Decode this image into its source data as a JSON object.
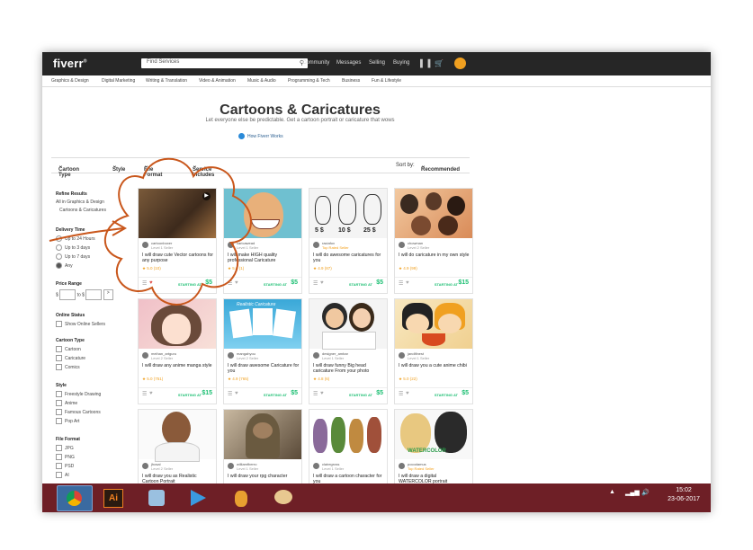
{
  "header": {
    "logo": "fiverr",
    "logo_mark": "®",
    "search_placeholder": "Find Services",
    "nav": [
      "Community",
      "Messages",
      "Selling",
      "Buying"
    ]
  },
  "categories": [
    "Graphics & Design",
    "Digital Marketing",
    "Writing & Translation",
    "Video & Animation",
    "Music & Audio",
    "Programming & Tech",
    "Business",
    "Fun & Lifestyle"
  ],
  "page": {
    "title": "Cartoons & Caricatures",
    "subtitle": "Let everyone else be predictable. Get a cartoon portrait or caricature that wows",
    "how_link": "How Fiverr Works"
  },
  "filters": {
    "cartoon_type": "Cartoon Type",
    "style": "Style",
    "file_format": "File Format",
    "service_includes": "Service Includes",
    "sort_label": "Sort by:",
    "sort_value": "Recommended"
  },
  "sidebar": {
    "refine": "Refine Results",
    "all_in": "All in Graphics & Design",
    "current": "Cartoons & Caricatures",
    "delivery_title": "Delivery Time",
    "delivery": [
      "Up to 24 Hours",
      "Up to 3 days",
      "Up to 7 days",
      "Any"
    ],
    "price_title": "Price Range",
    "price_from": "$",
    "price_to": "to $",
    "online_title": "Online Status",
    "online_opt": "Show Online Sellers",
    "type_title": "Cartoon Type",
    "type_opts": [
      "Cartoon",
      "Caricature",
      "Comics"
    ],
    "style_title": "Style",
    "style_opts": [
      "Freestyle Drawing",
      "Anime",
      "Famous Cartoons",
      "Pop Art"
    ],
    "format_title": "File Format",
    "format_opts": [
      "JPG",
      "PNG",
      "PSD",
      "AI"
    ]
  },
  "gigs": [
    {
      "seller": "cartoonboxer",
      "level": "Level 1 Seller",
      "desc": "I will draw cute Vector cartoons for any purpose",
      "rating": "5.0 (10)",
      "starting": "STARTING AT",
      "price": "$5"
    },
    {
      "seller": "caricawead",
      "level": "Level 1 Seller",
      "desc": "I will make HIGH quality professional Caricature",
      "rating": "5.0 (1)",
      "starting": "STARTING AT",
      "price": "$5"
    },
    {
      "seller": "raciafox",
      "level": "Top Rated Seller",
      "desc": "I will do awesome caricatures for you",
      "rating": "4.9 (87)",
      "starting": "STARTING AT",
      "price": "$5"
    },
    {
      "seller": "chowman",
      "level": "Level 2 Seller",
      "desc": "I will do caricature in my own style",
      "rating": "4.9 (99)",
      "starting": "STARTING AT",
      "price": "$15"
    },
    {
      "seller": "meihan_artguru",
      "level": "Level 2 Seller",
      "desc": "I will draw any anime manga style",
      "rating": "5.0 (751)",
      "starting": "STARTING AT",
      "price": "$15"
    },
    {
      "seller": "mangahyou",
      "level": "Level 2 Seller",
      "desc": "I will draw awesome Caricature for you",
      "rating": "4.9 (765)",
      "starting": "STARTING AT",
      "price": "$5"
    },
    {
      "seller": "designer_ambar",
      "level": "Level 1 Seller",
      "desc": "I will draw funny Big head caricature From your photo",
      "rating": "4.8 (6)",
      "starting": "STARTING AT",
      "price": "$5"
    },
    {
      "seller": "jandifinest",
      "level": "Level 1 Seller",
      "desc": "I will draw you a cute anime chibi",
      "rating": "5.0 (22)",
      "starting": "STARTING AT",
      "price": "$5"
    },
    {
      "seller": "jhosal",
      "level": "Level 2 Seller",
      "desc": "I will draw you as Realistic Cartoon Portrait",
      "rating": "",
      "starting": "",
      "price": ""
    },
    {
      "seller": "williamfberro",
      "level": "Level 1 Seller",
      "desc": "I will draw your rpg character",
      "rating": "",
      "starting": "",
      "price": ""
    },
    {
      "seller": "clairegross",
      "level": "Level 1 Seller",
      "desc": "I will draw a cartoon character for you",
      "rating": "",
      "starting": "",
      "price": ""
    },
    {
      "seller": "pocodamus",
      "level": "Top Rated Seller",
      "desc": "I will draw a digital WATERCOLOR portrait",
      "rating": "",
      "starting": "",
      "price": ""
    }
  ],
  "card_images": {
    "c2": "WATERCOLOR",
    "c3_prices": [
      "5 $",
      "10 $",
      "25 $"
    ],
    "c6_banner": "Realistic Caricature"
  },
  "annotation": {
    "color": "#c9571c"
  },
  "taskbar": {
    "apps": [
      "chrome",
      "illustrator",
      "paint-app",
      "media-player",
      "pineapple-app",
      "paint-palette"
    ],
    "ai_label": "Ai",
    "time": "15:02",
    "date": "23-06-2017"
  }
}
